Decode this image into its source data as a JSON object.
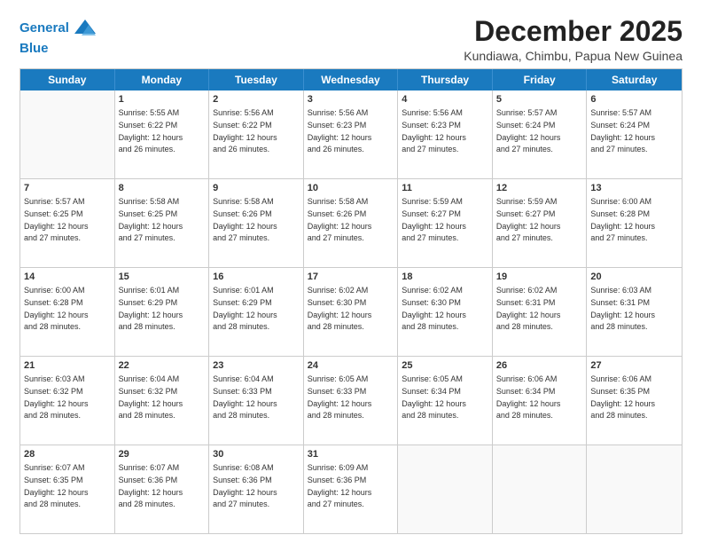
{
  "logo": {
    "line1": "General",
    "line2": "Blue"
  },
  "title": "December 2025",
  "subtitle": "Kundiawa, Chimbu, Papua New Guinea",
  "days": [
    "Sunday",
    "Monday",
    "Tuesday",
    "Wednesday",
    "Thursday",
    "Friday",
    "Saturday"
  ],
  "weeks": [
    [
      {
        "day": "",
        "info": ""
      },
      {
        "day": "1",
        "info": "Sunrise: 5:55 AM\nSunset: 6:22 PM\nDaylight: 12 hours\nand 26 minutes."
      },
      {
        "day": "2",
        "info": "Sunrise: 5:56 AM\nSunset: 6:22 PM\nDaylight: 12 hours\nand 26 minutes."
      },
      {
        "day": "3",
        "info": "Sunrise: 5:56 AM\nSunset: 6:23 PM\nDaylight: 12 hours\nand 26 minutes."
      },
      {
        "day": "4",
        "info": "Sunrise: 5:56 AM\nSunset: 6:23 PM\nDaylight: 12 hours\nand 27 minutes."
      },
      {
        "day": "5",
        "info": "Sunrise: 5:57 AM\nSunset: 6:24 PM\nDaylight: 12 hours\nand 27 minutes."
      },
      {
        "day": "6",
        "info": "Sunrise: 5:57 AM\nSunset: 6:24 PM\nDaylight: 12 hours\nand 27 minutes."
      }
    ],
    [
      {
        "day": "7",
        "info": "Sunrise: 5:57 AM\nSunset: 6:25 PM\nDaylight: 12 hours\nand 27 minutes."
      },
      {
        "day": "8",
        "info": "Sunrise: 5:58 AM\nSunset: 6:25 PM\nDaylight: 12 hours\nand 27 minutes."
      },
      {
        "day": "9",
        "info": "Sunrise: 5:58 AM\nSunset: 6:26 PM\nDaylight: 12 hours\nand 27 minutes."
      },
      {
        "day": "10",
        "info": "Sunrise: 5:58 AM\nSunset: 6:26 PM\nDaylight: 12 hours\nand 27 minutes."
      },
      {
        "day": "11",
        "info": "Sunrise: 5:59 AM\nSunset: 6:27 PM\nDaylight: 12 hours\nand 27 minutes."
      },
      {
        "day": "12",
        "info": "Sunrise: 5:59 AM\nSunset: 6:27 PM\nDaylight: 12 hours\nand 27 minutes."
      },
      {
        "day": "13",
        "info": "Sunrise: 6:00 AM\nSunset: 6:28 PM\nDaylight: 12 hours\nand 27 minutes."
      }
    ],
    [
      {
        "day": "14",
        "info": "Sunrise: 6:00 AM\nSunset: 6:28 PM\nDaylight: 12 hours\nand 28 minutes."
      },
      {
        "day": "15",
        "info": "Sunrise: 6:01 AM\nSunset: 6:29 PM\nDaylight: 12 hours\nand 28 minutes."
      },
      {
        "day": "16",
        "info": "Sunrise: 6:01 AM\nSunset: 6:29 PM\nDaylight: 12 hours\nand 28 minutes."
      },
      {
        "day": "17",
        "info": "Sunrise: 6:02 AM\nSunset: 6:30 PM\nDaylight: 12 hours\nand 28 minutes."
      },
      {
        "day": "18",
        "info": "Sunrise: 6:02 AM\nSunset: 6:30 PM\nDaylight: 12 hours\nand 28 minutes."
      },
      {
        "day": "19",
        "info": "Sunrise: 6:02 AM\nSunset: 6:31 PM\nDaylight: 12 hours\nand 28 minutes."
      },
      {
        "day": "20",
        "info": "Sunrise: 6:03 AM\nSunset: 6:31 PM\nDaylight: 12 hours\nand 28 minutes."
      }
    ],
    [
      {
        "day": "21",
        "info": "Sunrise: 6:03 AM\nSunset: 6:32 PM\nDaylight: 12 hours\nand 28 minutes."
      },
      {
        "day": "22",
        "info": "Sunrise: 6:04 AM\nSunset: 6:32 PM\nDaylight: 12 hours\nand 28 minutes."
      },
      {
        "day": "23",
        "info": "Sunrise: 6:04 AM\nSunset: 6:33 PM\nDaylight: 12 hours\nand 28 minutes."
      },
      {
        "day": "24",
        "info": "Sunrise: 6:05 AM\nSunset: 6:33 PM\nDaylight: 12 hours\nand 28 minutes."
      },
      {
        "day": "25",
        "info": "Sunrise: 6:05 AM\nSunset: 6:34 PM\nDaylight: 12 hours\nand 28 minutes."
      },
      {
        "day": "26",
        "info": "Sunrise: 6:06 AM\nSunset: 6:34 PM\nDaylight: 12 hours\nand 28 minutes."
      },
      {
        "day": "27",
        "info": "Sunrise: 6:06 AM\nSunset: 6:35 PM\nDaylight: 12 hours\nand 28 minutes."
      }
    ],
    [
      {
        "day": "28",
        "info": "Sunrise: 6:07 AM\nSunset: 6:35 PM\nDaylight: 12 hours\nand 28 minutes."
      },
      {
        "day": "29",
        "info": "Sunrise: 6:07 AM\nSunset: 6:36 PM\nDaylight: 12 hours\nand 28 minutes."
      },
      {
        "day": "30",
        "info": "Sunrise: 6:08 AM\nSunset: 6:36 PM\nDaylight: 12 hours\nand 27 minutes."
      },
      {
        "day": "31",
        "info": "Sunrise: 6:09 AM\nSunset: 6:36 PM\nDaylight: 12 hours\nand 27 minutes."
      },
      {
        "day": "",
        "info": ""
      },
      {
        "day": "",
        "info": ""
      },
      {
        "day": "",
        "info": ""
      }
    ]
  ]
}
